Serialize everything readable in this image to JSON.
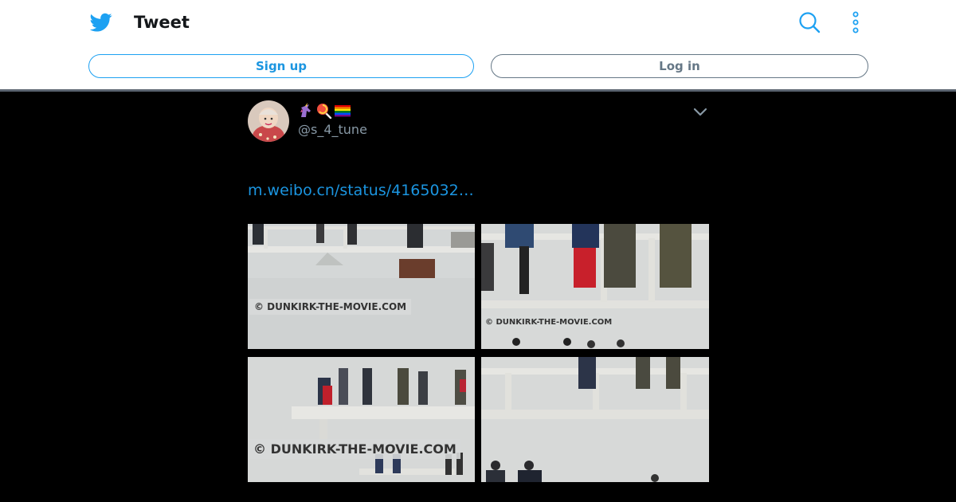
{
  "header": {
    "title": "Tweet",
    "signup_label": "Sign up",
    "login_label": "Log in",
    "logo_icon": "twitter-bird-icon",
    "search_icon": "search-icon",
    "more_icon": "more-vertical-icon"
  },
  "tweet": {
    "handle": "@s_4_tune",
    "display_name_emojis": [
      "unicorn",
      "lollipop",
      "rainbow-flag"
    ],
    "link_text": "m.weibo.cn/status/4165032…",
    "photos": [
      {
        "watermark": "© DUNKIRK-THE-MOVIE.COM"
      },
      {
        "watermark": "© DUNKIRK-THE-MOVIE.COM"
      },
      {
        "watermark": "© DUNKIRK-THE-MOVIE.COM"
      },
      {
        "watermark": ""
      }
    ]
  },
  "colors": {
    "brand_blue": "#1da1f2",
    "link_blue": "#1b95e0",
    "muted": "#657786",
    "background": "#000000"
  }
}
